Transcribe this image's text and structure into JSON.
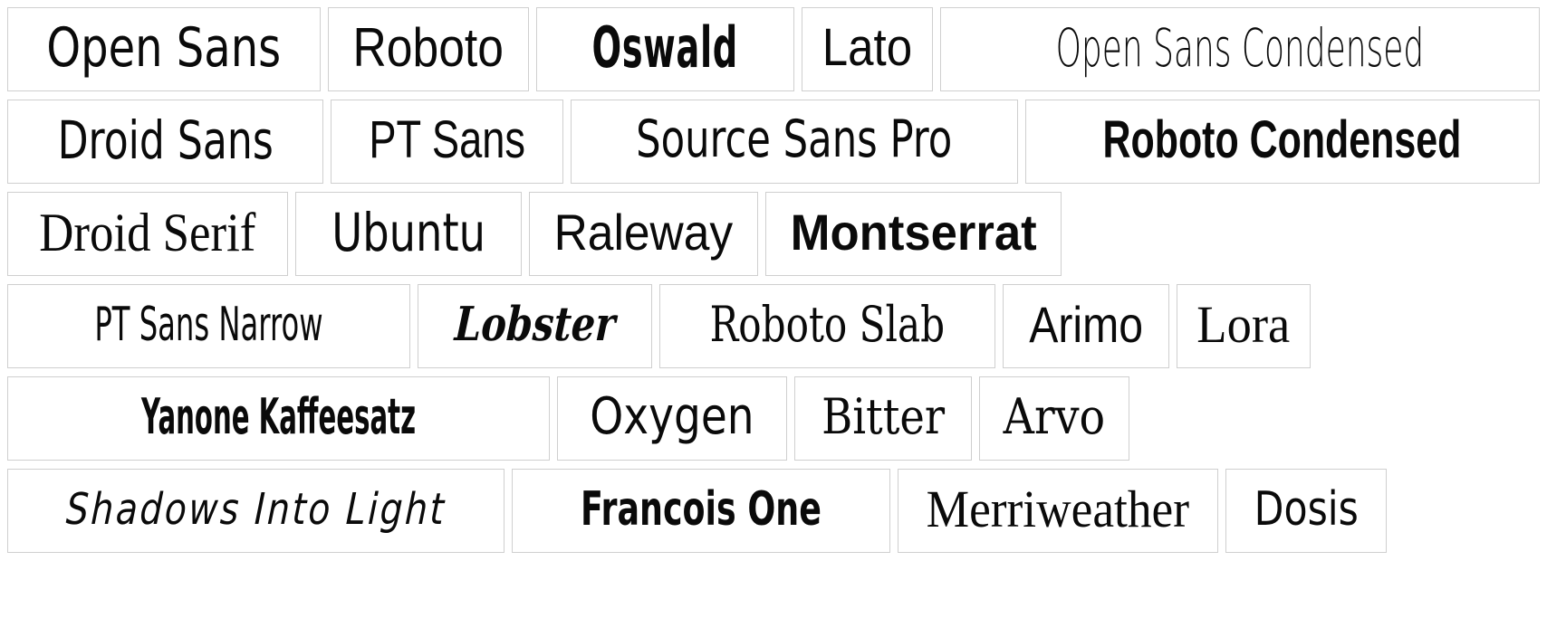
{
  "page": {
    "title": "Google Web Fonts Specimen Grid",
    "background_color": "#ffffff",
    "card_border_color": "#cfcfcf",
    "text_color": "#0a0a0a"
  },
  "rows": [
    {
      "index": 1,
      "cards": [
        {
          "label": "Open Sans",
          "style_class": "f-open-sans",
          "category": "sans-serif",
          "weight": "regular"
        },
        {
          "label": "Roboto",
          "style_class": "f-roboto",
          "category": "sans-serif",
          "weight": "regular"
        },
        {
          "label": "Oswald",
          "style_class": "f-oswald",
          "category": "sans-serif-condensed",
          "weight": "bold"
        },
        {
          "label": "Lato",
          "style_class": "f-lato",
          "category": "sans-serif",
          "weight": "regular"
        },
        {
          "label": "Open Sans Condensed",
          "style_class": "f-open-sans-cond",
          "category": "sans-serif-condensed",
          "weight": "light"
        }
      ]
    },
    {
      "index": 2,
      "cards": [
        {
          "label": "Droid Sans",
          "style_class": "f-droid-sans",
          "category": "sans-serif",
          "weight": "regular"
        },
        {
          "label": "PT Sans",
          "style_class": "f-pt-sans",
          "category": "sans-serif",
          "weight": "regular"
        },
        {
          "label": "Source Sans Pro",
          "style_class": "f-source-sans-pro",
          "category": "sans-serif",
          "weight": "regular"
        },
        {
          "label": "Roboto Condensed",
          "style_class": "f-roboto-cond",
          "category": "sans-serif-condensed",
          "weight": "bold"
        }
      ]
    },
    {
      "index": 3,
      "cards": [
        {
          "label": "Droid Serif",
          "style_class": "f-droid-serif",
          "category": "serif",
          "weight": "regular"
        },
        {
          "label": "Ubuntu",
          "style_class": "f-ubuntu",
          "category": "sans-serif",
          "weight": "regular"
        },
        {
          "label": "Raleway",
          "style_class": "f-raleway",
          "category": "sans-serif",
          "weight": "light"
        },
        {
          "label": "Montserrat",
          "style_class": "f-montserrat",
          "category": "sans-serif",
          "weight": "bold"
        }
      ]
    },
    {
      "index": 4,
      "cards": [
        {
          "label": "PT Sans Narrow",
          "style_class": "f-pt-sans-narrow",
          "category": "sans-serif-condensed",
          "weight": "regular"
        },
        {
          "label": "Lobster",
          "style_class": "f-lobster",
          "category": "script",
          "weight": "bold-italic"
        },
        {
          "label": "Roboto Slab",
          "style_class": "f-roboto-slab",
          "category": "slab-serif",
          "weight": "regular"
        },
        {
          "label": "Arimo",
          "style_class": "f-arimo",
          "category": "sans-serif",
          "weight": "regular"
        },
        {
          "label": "Lora",
          "style_class": "f-lora",
          "category": "serif",
          "weight": "regular"
        }
      ]
    },
    {
      "index": 5,
      "cards": [
        {
          "label": "Yanone Kaffeesatz",
          "style_class": "f-yanone",
          "category": "sans-serif-condensed",
          "weight": "bold"
        },
        {
          "label": "Oxygen",
          "style_class": "f-oxygen",
          "category": "sans-serif",
          "weight": "regular"
        },
        {
          "label": "Bitter",
          "style_class": "f-bitter",
          "category": "slab-serif",
          "weight": "regular"
        },
        {
          "label": "Arvo",
          "style_class": "f-arvo",
          "category": "slab-serif",
          "weight": "regular"
        }
      ]
    },
    {
      "index": 6,
      "cards": [
        {
          "label": "Shadows Into Light",
          "style_class": "f-shadows",
          "category": "handwriting",
          "weight": "regular"
        },
        {
          "label": "Francois One",
          "style_class": "f-francois-one",
          "category": "sans-serif-condensed",
          "weight": "bold"
        },
        {
          "label": "Merriweather",
          "style_class": "f-merriweather",
          "category": "serif",
          "weight": "regular"
        },
        {
          "label": "Dosis",
          "style_class": "f-dosis",
          "category": "sans-serif",
          "weight": "regular"
        }
      ]
    }
  ]
}
